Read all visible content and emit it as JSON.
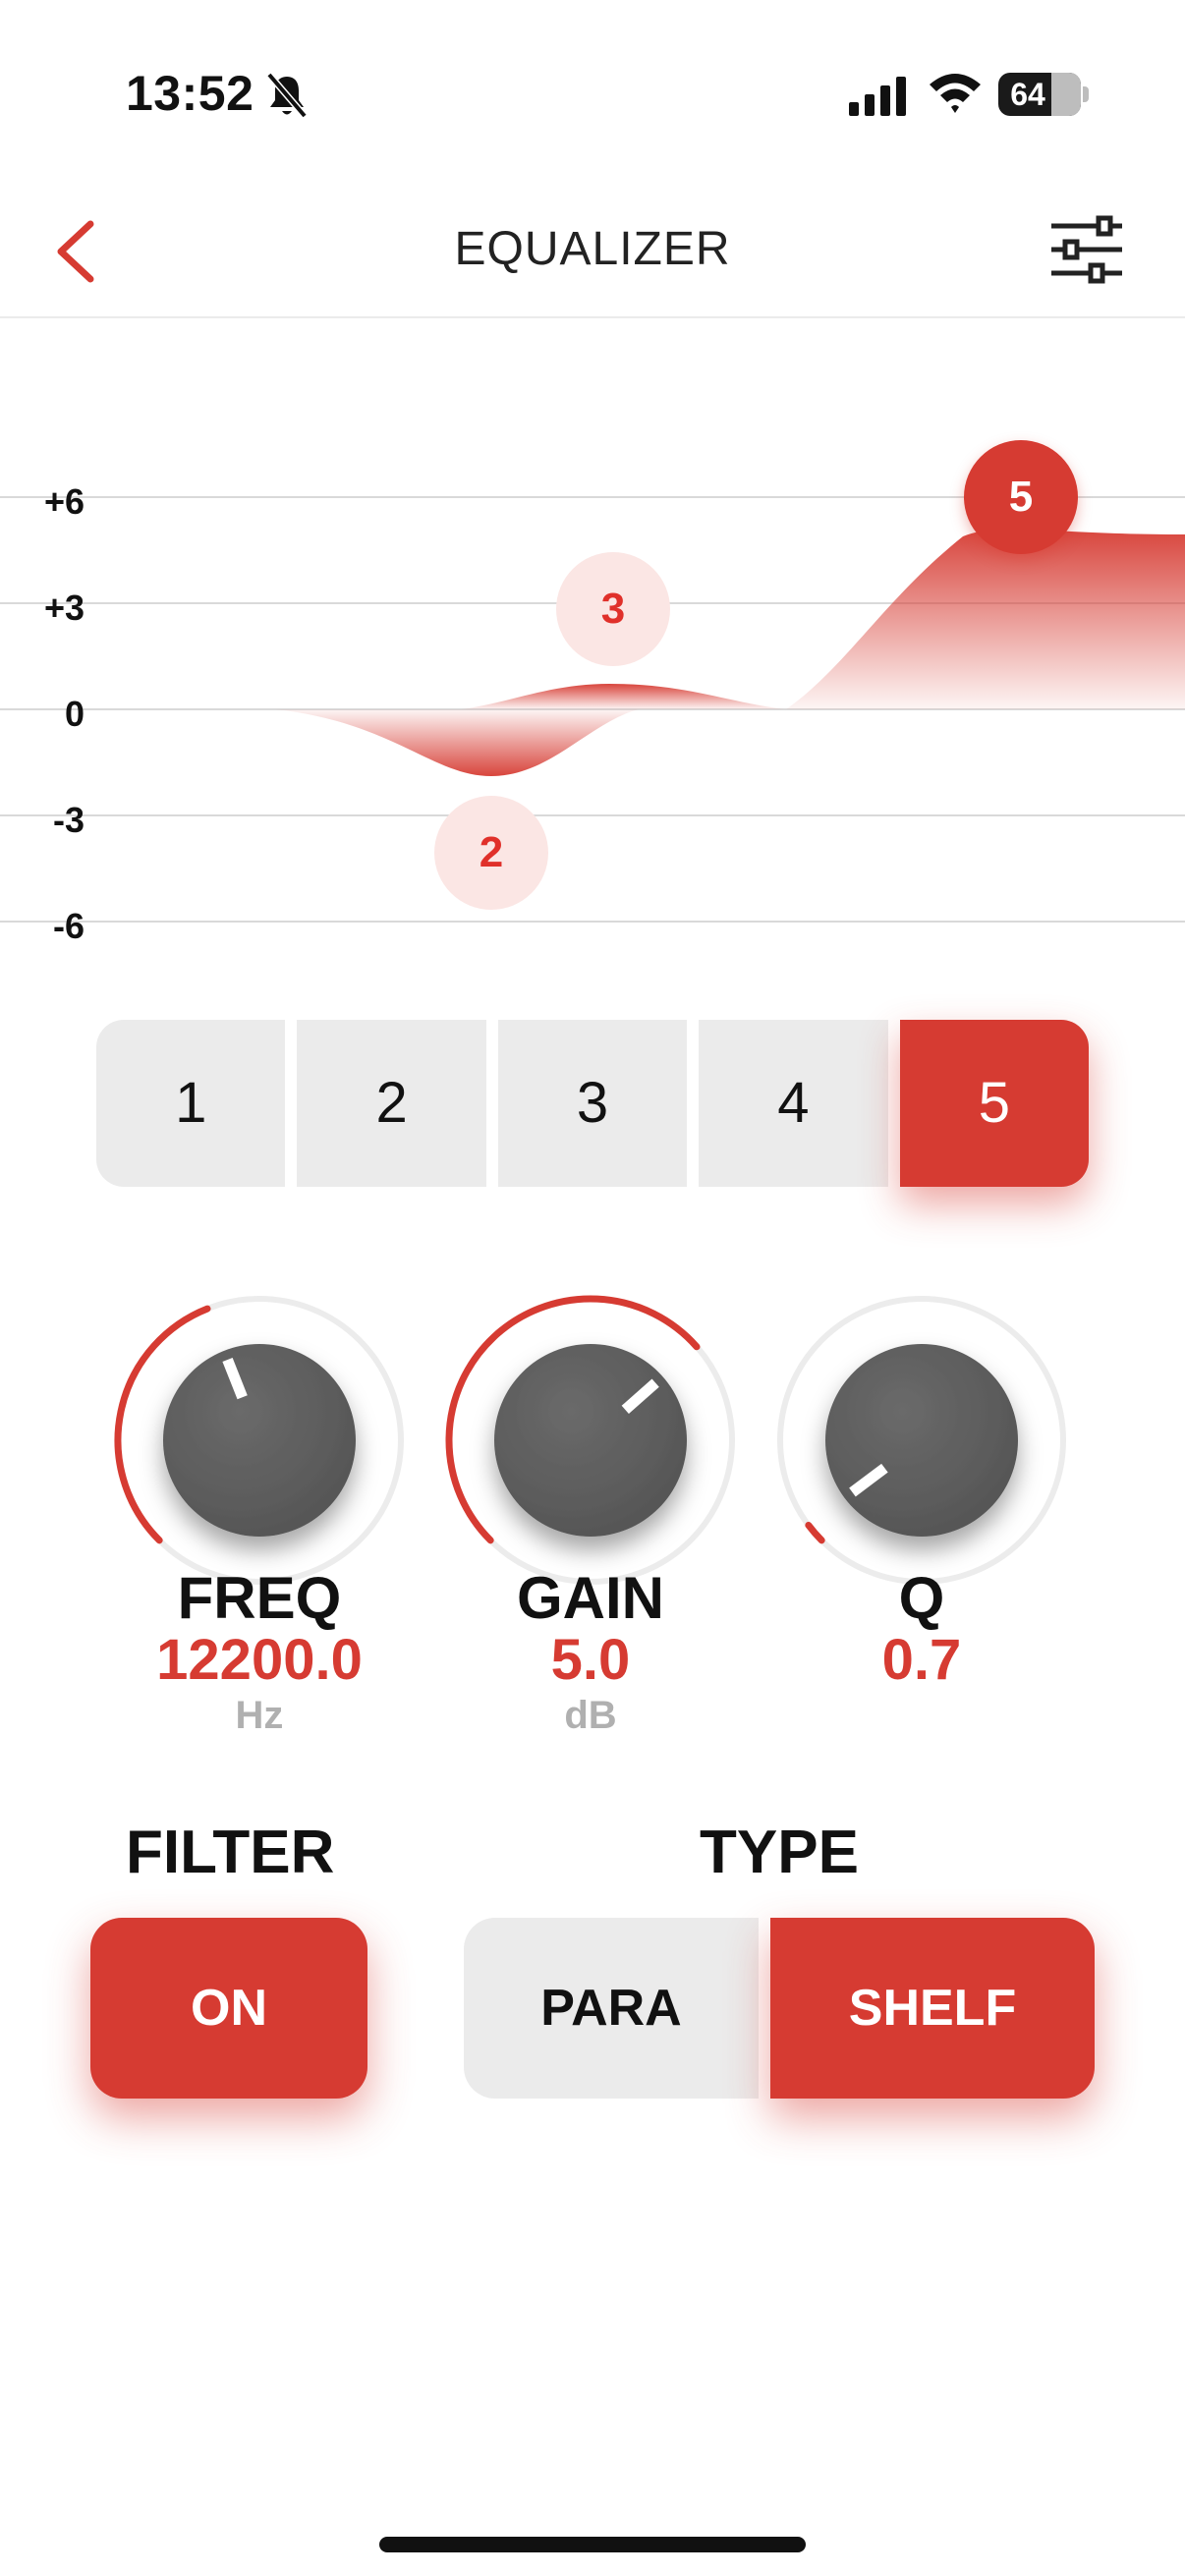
{
  "status_bar": {
    "time": "13:52",
    "battery": "64"
  },
  "header": {
    "title": "EQUALIZER"
  },
  "graph": {
    "y_labels": [
      "+6",
      "+3",
      "0",
      "-3",
      "-6"
    ],
    "markers": [
      {
        "band": "2",
        "gain_db": -2.0
      },
      {
        "band": "3",
        "gain_db": 0.8
      },
      {
        "band": "5",
        "gain_db": 5.0
      }
    ]
  },
  "bands": {
    "items": [
      "1",
      "2",
      "3",
      "4",
      "5"
    ],
    "selected": "5"
  },
  "knobs": {
    "freq": {
      "label": "FREQ",
      "value": "12200.0",
      "unit": "Hz",
      "level": 0.42
    },
    "gain": {
      "label": "GAIN",
      "value": "5.0",
      "unit": "dB",
      "level": 0.68
    },
    "q": {
      "label": "Q",
      "value": "0.7",
      "unit": "",
      "level": 0.03
    }
  },
  "filter": {
    "label": "FILTER",
    "state": "ON"
  },
  "type": {
    "label": "TYPE",
    "options": [
      "PARA",
      "SHELF"
    ],
    "selected": "SHELF"
  },
  "colors": {
    "accent": "#d63b32",
    "accent_soft": "#fbe6e4",
    "button_grey": "#ebebeb",
    "knob": "#555555",
    "label_muted": "#b0b0b0"
  }
}
